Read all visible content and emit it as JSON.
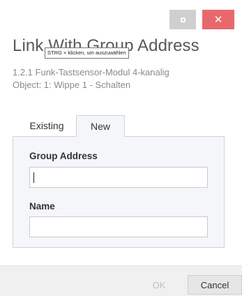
{
  "window": {
    "restore_icon": "restore-icon",
    "close_glyph": "✕",
    "close_icon": "close-icon"
  },
  "dialog": {
    "title": "Link With Group Address",
    "tooltip": "STRG + klicken, um auszuwählen",
    "device": "1.2.1 Funk-Tastsensor-Modul  4-kanalig",
    "object": "Object: 1: Wippe 1 - Schalten"
  },
  "tabs": [
    {
      "label": "Existing",
      "active": false
    },
    {
      "label": "New",
      "active": true
    }
  ],
  "form": {
    "group_address": {
      "label": "Group Address",
      "value": ""
    },
    "name": {
      "label": "Name",
      "value": ""
    }
  },
  "buttons": {
    "ok_label": "OK",
    "ok_enabled": false,
    "cancel_label": "Cancel"
  },
  "colors": {
    "close_button": "#e8696c",
    "panel_background": "#f4f6f9"
  }
}
